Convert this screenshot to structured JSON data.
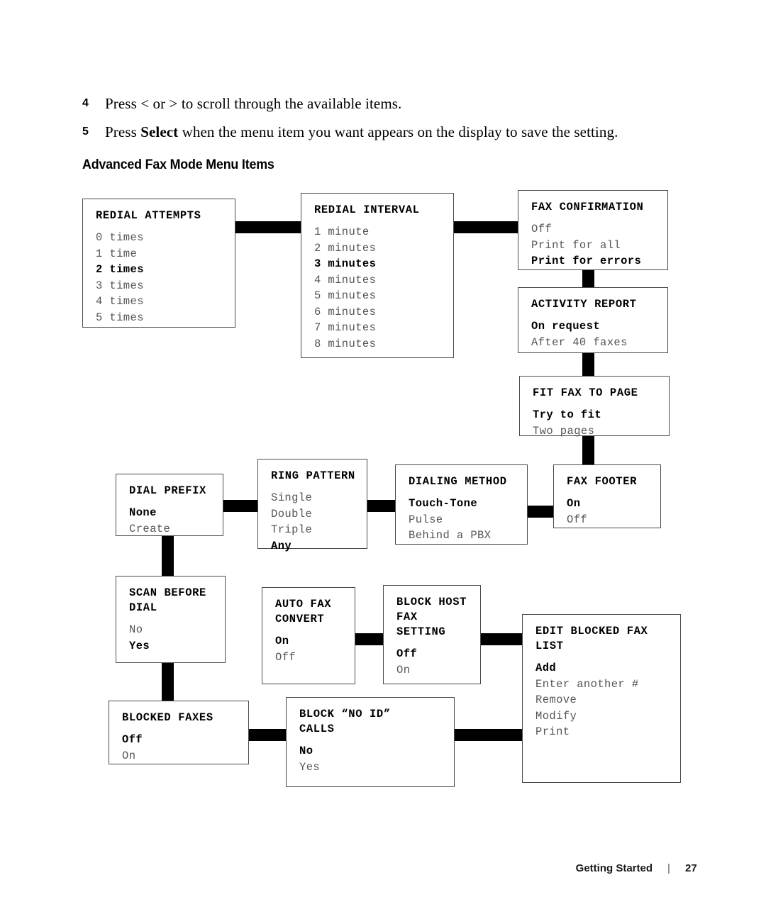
{
  "steps": [
    {
      "num": "4",
      "pre": "Press < or > to scroll through the available items.",
      "bold": "",
      "post": ""
    },
    {
      "num": "5",
      "pre": "Press ",
      "bold": "Select",
      "post": " when the menu item you want appears on the display to save the setting."
    }
  ],
  "section_heading": "Advanced Fax Mode Menu Items",
  "boxes": {
    "redial_attempts": {
      "title": "REDIAL ATTEMPTS",
      "options": [
        "0 times",
        "1 time",
        "2 times",
        "3 times",
        "4 times",
        "5 times"
      ],
      "selected": "2 times"
    },
    "redial_interval": {
      "title": "REDIAL INTERVAL",
      "options": [
        "1 minute",
        "2 minutes",
        "3 minutes",
        "4 minutes",
        "5 minutes",
        "6 minutes",
        "7 minutes",
        "8 minutes"
      ],
      "selected": "3 minutes"
    },
    "fax_confirmation": {
      "title": "FAX CONFIRMATION",
      "options": [
        "Off",
        "Print for all",
        "Print for errors"
      ],
      "selected": "Print for errors"
    },
    "activity_report": {
      "title": "ACTIVITY REPORT",
      "options": [
        "On request",
        "After 40 faxes"
      ],
      "selected": "On request"
    },
    "fit_fax_to_page": {
      "title": "FIT FAX TO PAGE",
      "options": [
        "Try to fit",
        "Two pages"
      ],
      "selected": "Try to fit"
    },
    "dial_prefix": {
      "title": "DIAL PREFIX",
      "options": [
        "None",
        "Create"
      ],
      "selected": "None"
    },
    "ring_pattern": {
      "title": "RING PATTERN",
      "options": [
        "Single",
        "Double",
        "Triple",
        "Any"
      ],
      "selected": "Any"
    },
    "dialing_method": {
      "title": "DIALING METHOD",
      "options": [
        "Touch-Tone",
        "Pulse",
        "Behind a PBX"
      ],
      "selected": "Touch-Tone"
    },
    "fax_footer": {
      "title": "FAX FOOTER",
      "options": [
        "On",
        "Off"
      ],
      "selected": "On"
    },
    "scan_before_dial": {
      "title": "SCAN BEFORE\nDIAL",
      "options": [
        "No",
        "Yes"
      ],
      "selected": "Yes"
    },
    "auto_fax_convert": {
      "title": "AUTO FAX\nCONVERT",
      "options": [
        "On",
        "Off"
      ],
      "selected": "On"
    },
    "block_host_fax_setting": {
      "title": "BLOCK HOST\nFAX\nSETTING",
      "options": [
        "Off",
        "On"
      ],
      "selected": "Off"
    },
    "edit_blocked_fax_list": {
      "title": "EDIT BLOCKED FAX\nLIST",
      "options": [
        "Add",
        "Enter another #",
        "Remove",
        "Modify",
        "Print"
      ],
      "selected": "Add"
    },
    "blocked_faxes": {
      "title": "BLOCKED FAXES",
      "options": [
        "Off",
        "On"
      ],
      "selected": "Off"
    },
    "block_no_id_calls": {
      "title": "BLOCK “NO ID”\nCALLS",
      "options": [
        "No",
        "Yes"
      ],
      "selected": "No"
    }
  },
  "footer": {
    "label": "Getting Started",
    "separator": "|",
    "page": "27"
  }
}
